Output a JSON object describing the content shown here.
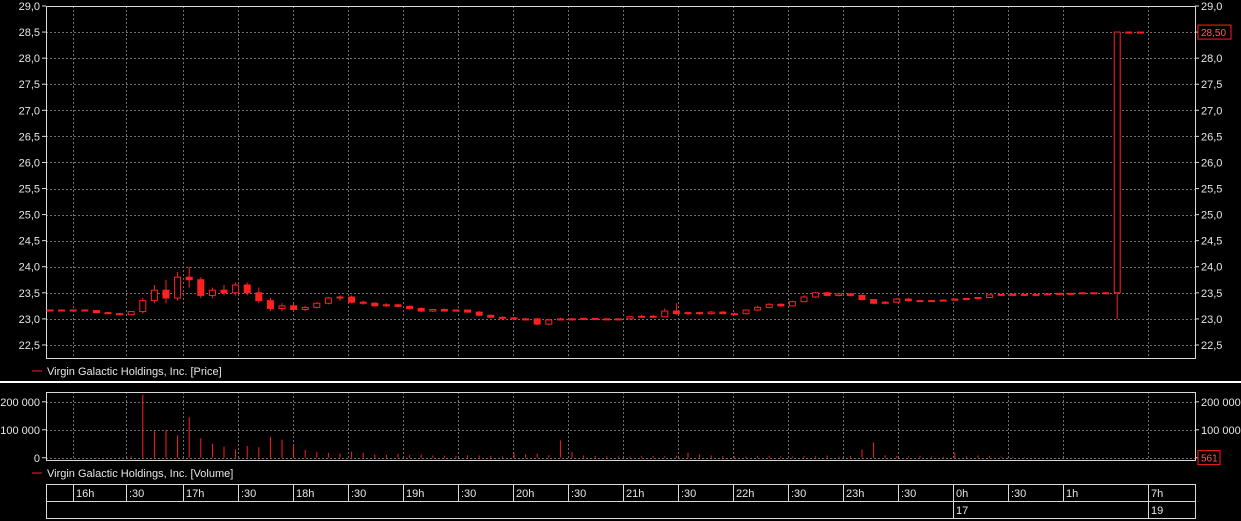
{
  "colors": {
    "background": "#000000",
    "grid": "#6e6e6e",
    "axis": "#d8d8d8",
    "series": "#ff2020",
    "separator": "#ffffff"
  },
  "chart_data": [
    {
      "type": "candlestick",
      "legend": "Virgin Galactic Holdings, Inc. [Price]",
      "ylim": [
        22.25,
        29.0
      ],
      "y_ticks": [
        "29,0",
        "28,5",
        "28,0",
        "27,5",
        "27,0",
        "26,5",
        "26,0",
        "25,5",
        "25,0",
        "24,5",
        "24,0",
        "23,5",
        "23,0",
        "22,5"
      ],
      "y_tick_values": [
        29.0,
        28.5,
        28.0,
        27.5,
        27.0,
        26.5,
        26.0,
        25.5,
        25.0,
        24.5,
        24.0,
        23.5,
        23.0,
        22.5
      ],
      "last_value_label": "28,50",
      "last_value": 28.5,
      "grid": true,
      "x_unit": "bar index (10-minute bars)",
      "candles": [
        {
          "x": 0,
          "o": 23.17,
          "h": 23.18,
          "l": 23.16,
          "c": 23.17
        },
        {
          "x": 1,
          "o": 23.17,
          "h": 23.18,
          "l": 23.16,
          "c": 23.17
        },
        {
          "x": 2,
          "o": 23.17,
          "h": 23.18,
          "l": 23.16,
          "c": 23.17
        },
        {
          "x": 3,
          "o": 23.17,
          "h": 23.18,
          "l": 23.15,
          "c": 23.16
        },
        {
          "x": 4,
          "o": 23.16,
          "h": 23.17,
          "l": 23.12,
          "c": 23.12
        },
        {
          "x": 5,
          "o": 23.12,
          "h": 23.13,
          "l": 23.09,
          "c": 23.1
        },
        {
          "x": 6,
          "o": 23.1,
          "h": 23.11,
          "l": 23.07,
          "c": 23.08
        },
        {
          "x": 7,
          "o": 23.08,
          "h": 23.15,
          "l": 23.07,
          "c": 23.14
        },
        {
          "x": 8,
          "o": 23.14,
          "h": 23.4,
          "l": 23.1,
          "c": 23.35
        },
        {
          "x": 9,
          "o": 23.35,
          "h": 23.65,
          "l": 23.3,
          "c": 23.55
        },
        {
          "x": 10,
          "o": 23.55,
          "h": 23.75,
          "l": 23.3,
          "c": 23.4
        },
        {
          "x": 11,
          "o": 23.4,
          "h": 23.9,
          "l": 23.35,
          "c": 23.8
        },
        {
          "x": 12,
          "o": 23.8,
          "h": 24.0,
          "l": 23.6,
          "c": 23.75
        },
        {
          "x": 13,
          "o": 23.75,
          "h": 23.8,
          "l": 23.4,
          "c": 23.45
        },
        {
          "x": 14,
          "o": 23.45,
          "h": 23.6,
          "l": 23.4,
          "c": 23.55
        },
        {
          "x": 15,
          "o": 23.55,
          "h": 23.65,
          "l": 23.45,
          "c": 23.5
        },
        {
          "x": 16,
          "o": 23.5,
          "h": 23.7,
          "l": 23.45,
          "c": 23.65
        },
        {
          "x": 17,
          "o": 23.65,
          "h": 23.7,
          "l": 23.45,
          "c": 23.5
        },
        {
          "x": 18,
          "o": 23.5,
          "h": 23.6,
          "l": 23.3,
          "c": 23.35
        },
        {
          "x": 19,
          "o": 23.35,
          "h": 23.4,
          "l": 23.15,
          "c": 23.2
        },
        {
          "x": 20,
          "o": 23.2,
          "h": 23.3,
          "l": 23.15,
          "c": 23.25
        },
        {
          "x": 21,
          "o": 23.25,
          "h": 23.3,
          "l": 23.15,
          "c": 23.18
        },
        {
          "x": 22,
          "o": 23.18,
          "h": 23.25,
          "l": 23.15,
          "c": 23.22
        },
        {
          "x": 23,
          "o": 23.22,
          "h": 23.32,
          "l": 23.2,
          "c": 23.3
        },
        {
          "x": 24,
          "o": 23.3,
          "h": 23.42,
          "l": 23.28,
          "c": 23.4
        },
        {
          "x": 25,
          "o": 23.4,
          "h": 23.45,
          "l": 23.35,
          "c": 23.42
        },
        {
          "x": 26,
          "o": 23.42,
          "h": 23.45,
          "l": 23.3,
          "c": 23.32
        },
        {
          "x": 27,
          "o": 23.32,
          "h": 23.35,
          "l": 23.27,
          "c": 23.3
        },
        {
          "x": 28,
          "o": 23.3,
          "h": 23.32,
          "l": 23.24,
          "c": 23.25
        },
        {
          "x": 29,
          "o": 23.25,
          "h": 23.3,
          "l": 23.23,
          "c": 23.27
        },
        {
          "x": 30,
          "o": 23.27,
          "h": 23.29,
          "l": 23.22,
          "c": 23.24
        },
        {
          "x": 31,
          "o": 23.24,
          "h": 23.26,
          "l": 23.18,
          "c": 23.2
        },
        {
          "x": 32,
          "o": 23.2,
          "h": 23.22,
          "l": 23.13,
          "c": 23.15
        },
        {
          "x": 33,
          "o": 23.15,
          "h": 23.19,
          "l": 23.13,
          "c": 23.18
        },
        {
          "x": 34,
          "o": 23.18,
          "h": 23.2,
          "l": 23.14,
          "c": 23.15
        },
        {
          "x": 35,
          "o": 23.15,
          "h": 23.18,
          "l": 23.14,
          "c": 23.17
        },
        {
          "x": 36,
          "o": 23.17,
          "h": 23.18,
          "l": 23.12,
          "c": 23.13
        },
        {
          "x": 37,
          "o": 23.13,
          "h": 23.15,
          "l": 23.05,
          "c": 23.07
        },
        {
          "x": 38,
          "o": 23.07,
          "h": 23.08,
          "l": 23.02,
          "c": 23.03
        },
        {
          "x": 39,
          "o": 23.03,
          "h": 23.05,
          "l": 23.0,
          "c": 23.02
        },
        {
          "x": 40,
          "o": 23.02,
          "h": 23.04,
          "l": 22.98,
          "c": 23.0
        },
        {
          "x": 41,
          "o": 23.0,
          "h": 23.02,
          "l": 22.98,
          "c": 23.0
        },
        {
          "x": 42,
          "o": 23.0,
          "h": 23.02,
          "l": 22.88,
          "c": 22.9
        },
        {
          "x": 43,
          "o": 22.9,
          "h": 23.0,
          "l": 22.88,
          "c": 22.98
        },
        {
          "x": 44,
          "o": 22.98,
          "h": 23.02,
          "l": 22.97,
          "c": 23.0
        },
        {
          "x": 45,
          "o": 23.0,
          "h": 23.02,
          "l": 22.98,
          "c": 23.0
        },
        {
          "x": 46,
          "o": 23.0,
          "h": 23.02,
          "l": 22.98,
          "c": 23.01
        },
        {
          "x": 47,
          "o": 23.01,
          "h": 23.02,
          "l": 22.99,
          "c": 23.0
        },
        {
          "x": 48,
          "o": 23.0,
          "h": 23.01,
          "l": 22.98,
          "c": 22.99
        },
        {
          "x": 49,
          "o": 22.99,
          "h": 23.01,
          "l": 22.98,
          "c": 23.0
        },
        {
          "x": 50,
          "o": 23.0,
          "h": 23.05,
          "l": 22.99,
          "c": 23.04
        },
        {
          "x": 51,
          "o": 23.04,
          "h": 23.08,
          "l": 23.02,
          "c": 23.05
        },
        {
          "x": 52,
          "o": 23.05,
          "h": 23.08,
          "l": 23.02,
          "c": 23.04
        },
        {
          "x": 53,
          "o": 23.04,
          "h": 23.2,
          "l": 23.03,
          "c": 23.15
        },
        {
          "x": 54,
          "o": 23.15,
          "h": 23.3,
          "l": 23.08,
          "c": 23.1
        },
        {
          "x": 55,
          "o": 23.1,
          "h": 23.14,
          "l": 23.07,
          "c": 23.12
        },
        {
          "x": 56,
          "o": 23.12,
          "h": 23.14,
          "l": 23.08,
          "c": 23.1
        },
        {
          "x": 57,
          "o": 23.1,
          "h": 23.15,
          "l": 23.08,
          "c": 23.13
        },
        {
          "x": 58,
          "o": 23.13,
          "h": 23.15,
          "l": 23.09,
          "c": 23.1
        },
        {
          "x": 59,
          "o": 23.1,
          "h": 23.12,
          "l": 23.08,
          "c": 23.1
        },
        {
          "x": 60,
          "o": 23.1,
          "h": 23.18,
          "l": 23.09,
          "c": 23.17
        },
        {
          "x": 61,
          "o": 23.17,
          "h": 23.25,
          "l": 23.15,
          "c": 23.22
        },
        {
          "x": 62,
          "o": 23.22,
          "h": 23.3,
          "l": 23.2,
          "c": 23.28
        },
        {
          "x": 63,
          "o": 23.28,
          "h": 23.3,
          "l": 23.23,
          "c": 23.25
        },
        {
          "x": 64,
          "o": 23.25,
          "h": 23.35,
          "l": 23.24,
          "c": 23.33
        },
        {
          "x": 65,
          "o": 23.33,
          "h": 23.45,
          "l": 23.32,
          "c": 23.42
        },
        {
          "x": 66,
          "o": 23.42,
          "h": 23.52,
          "l": 23.4,
          "c": 23.5
        },
        {
          "x": 67,
          "o": 23.5,
          "h": 23.52,
          "l": 23.43,
          "c": 23.45
        },
        {
          "x": 68,
          "o": 23.45,
          "h": 23.5,
          "l": 23.43,
          "c": 23.48
        },
        {
          "x": 69,
          "o": 23.48,
          "h": 23.5,
          "l": 23.43,
          "c": 23.45
        },
        {
          "x": 70,
          "o": 23.45,
          "h": 23.47,
          "l": 23.35,
          "c": 23.37
        },
        {
          "x": 71,
          "o": 23.37,
          "h": 23.38,
          "l": 23.28,
          "c": 23.3
        },
        {
          "x": 72,
          "o": 23.3,
          "h": 23.34,
          "l": 23.28,
          "c": 23.32
        },
        {
          "x": 73,
          "o": 23.32,
          "h": 23.4,
          "l": 23.31,
          "c": 23.38
        },
        {
          "x": 74,
          "o": 23.38,
          "h": 23.4,
          "l": 23.33,
          "c": 23.35
        },
        {
          "x": 75,
          "o": 23.35,
          "h": 23.37,
          "l": 23.33,
          "c": 23.34
        },
        {
          "x": 76,
          "o": 23.34,
          "h": 23.37,
          "l": 23.33,
          "c": 23.35
        },
        {
          "x": 77,
          "o": 23.35,
          "h": 23.37,
          "l": 23.34,
          "c": 23.36
        },
        {
          "x": 78,
          "o": 23.36,
          "h": 23.39,
          "l": 23.35,
          "c": 23.38
        },
        {
          "x": 79,
          "o": 23.38,
          "h": 23.4,
          "l": 23.37,
          "c": 23.39
        },
        {
          "x": 80,
          "o": 23.39,
          "h": 23.42,
          "l": 23.38,
          "c": 23.41
        },
        {
          "x": 81,
          "o": 23.41,
          "h": 23.47,
          "l": 23.4,
          "c": 23.46
        },
        {
          "x": 82,
          "o": 23.46,
          "h": 23.48,
          "l": 23.44,
          "c": 23.47
        },
        {
          "x": 83,
          "o": 23.47,
          "h": 23.49,
          "l": 23.45,
          "c": 23.46
        },
        {
          "x": 84,
          "o": 23.46,
          "h": 23.48,
          "l": 23.45,
          "c": 23.47
        },
        {
          "x": 85,
          "o": 23.47,
          "h": 23.48,
          "l": 23.45,
          "c": 23.46
        },
        {
          "x": 86,
          "o": 23.46,
          "h": 23.49,
          "l": 23.45,
          "c": 23.48
        },
        {
          "x": 87,
          "o": 23.48,
          "h": 23.5,
          "l": 23.47,
          "c": 23.49
        },
        {
          "x": 88,
          "o": 23.49,
          "h": 23.5,
          "l": 23.48,
          "c": 23.49
        },
        {
          "x": 89,
          "o": 23.49,
          "h": 23.5,
          "l": 23.48,
          "c": 23.5
        },
        {
          "x": 90,
          "o": 23.5,
          "h": 23.5,
          "l": 23.48,
          "c": 23.49
        },
        {
          "x": 91,
          "o": 23.49,
          "h": 23.52,
          "l": 23.48,
          "c": 23.5
        },
        {
          "x": 92,
          "o": 23.5,
          "h": 28.5,
          "l": 23.0,
          "c": 28.5
        },
        {
          "x": 93,
          "o": 28.5,
          "h": 28.5,
          "l": 28.5,
          "c": 28.5
        },
        {
          "x": 94,
          "o": 28.5,
          "h": 28.5,
          "l": 28.5,
          "c": 28.5
        }
      ]
    },
    {
      "type": "bar",
      "legend": "Virgin Galactic Holdings, Inc. [Volume]",
      "ylim": [
        -8000,
        235000
      ],
      "y_ticks": [
        "200 000",
        "100 000",
        "0"
      ],
      "y_tick_values": [
        200000,
        100000,
        0
      ],
      "last_value_label": "561",
      "last_value": 561,
      "x_unit": "bar index (10-minute bars)",
      "values": [
        1500,
        1200,
        1000,
        900,
        1100,
        1300,
        2000,
        5000,
        225000,
        95000,
        100000,
        80000,
        145000,
        70000,
        50000,
        40000,
        30000,
        42000,
        38000,
        75000,
        65000,
        48000,
        28000,
        20000,
        18000,
        15000,
        22000,
        18000,
        12000,
        10000,
        14000,
        9000,
        11000,
        8000,
        7500,
        6000,
        9000,
        8000,
        6500,
        5000,
        18000,
        12000,
        15000,
        9000,
        62000,
        20000,
        8000,
        6000,
        5000,
        4500,
        4000,
        5000,
        6000,
        5500,
        7000,
        18000,
        12000,
        8000,
        6000,
        5000,
        4000,
        6000,
        7000,
        5000,
        4500,
        6000,
        5000,
        8000,
        4000,
        6000,
        30000,
        55000,
        9000,
        7000,
        5000,
        6000,
        4000,
        3500,
        18000,
        5000,
        8000,
        6000,
        4000,
        3000,
        2000,
        1500,
        1200,
        1000,
        900,
        800,
        700,
        600,
        561,
        500,
        561
      ]
    }
  ],
  "x_axis": {
    "labels": [
      "16h",
      ":30",
      "17h",
      ":30",
      "18h",
      ":30",
      "19h",
      ":30",
      "20h",
      ":30",
      "21h",
      ":30",
      "22h",
      ":30",
      "23h",
      ":30",
      "0h",
      ":30",
      "1h",
      "7h"
    ],
    "date_labels": [
      "17",
      "19"
    ]
  }
}
